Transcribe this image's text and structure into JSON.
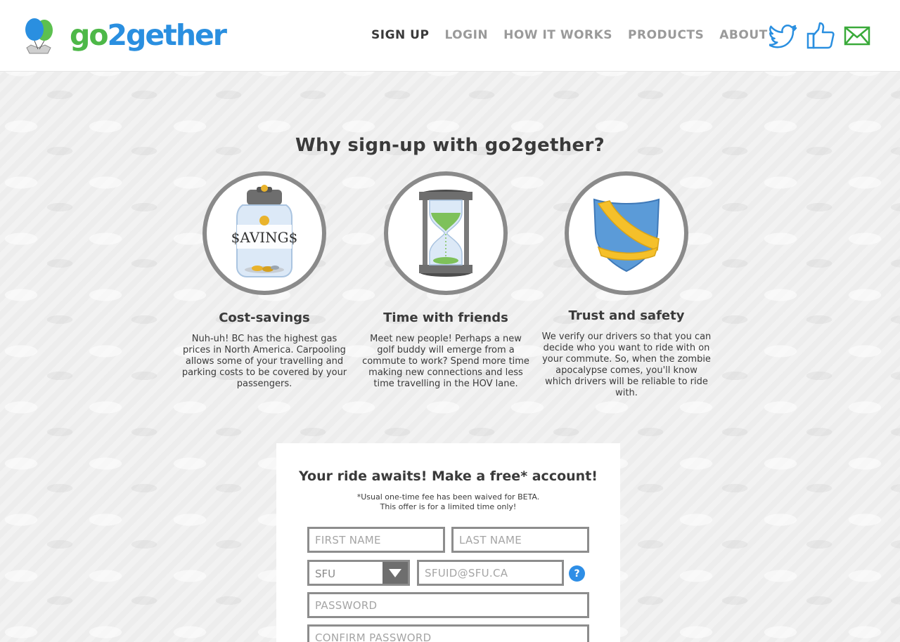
{
  "brand": {
    "logo_part1": "go",
    "logo_part2": "2gether"
  },
  "nav": [
    {
      "label": "SIGN UP"
    },
    {
      "label": "LOGIN"
    },
    {
      "label": "HOW IT WORKS"
    },
    {
      "label": "PRODUCTS"
    },
    {
      "label": "ABOUT"
    }
  ],
  "social_icons": [
    "twitter-icon",
    "like-thumb-icon",
    "email-icon"
  ],
  "intro": {
    "title": "Why sign-up with go2gether?",
    "features": [
      {
        "icon": "savings-jar-icon",
        "jar_label": "$AVING$",
        "heading": "Cost-savings",
        "text": "Nuh-uh! BC has the highest gas prices in North America. Carpooling allows some of your travelling and parking costs to be covered by your passengers."
      },
      {
        "icon": "hourglass-icon",
        "heading": "Time with friends",
        "text": "Meet new people! Perhaps a new golf buddy will emerge from a commute to work? Spend more time making new connections and less time travelling in the HOV lane."
      },
      {
        "icon": "shield-icon",
        "heading": "Trust and safety",
        "text": "We verify our drivers so that you can decide who you want to ride with on your commute. So, when the zombie apocalypse comes, you'll know which drivers will be reliable to ride with."
      }
    ]
  },
  "signup": {
    "title": "Your ride awaits! Make a free* account!",
    "fine_line1": "*Usual one-time fee has been waived for BETA.",
    "fine_line2": "This offer is for a limited time only!",
    "first_name_placeholder": "FIRST NAME",
    "last_name_placeholder": "LAST NAME",
    "school_selected": "SFU",
    "email_placeholder": "SFUID@SFU.CA",
    "help_label": "?",
    "password_placeholder": "PASSWORD",
    "confirm_password_placeholder": "CONFIRM PASSWORD"
  },
  "colors": {
    "brand_green": "#4db848",
    "brand_blue": "#2a8fe0",
    "shield_blue": "#5b9bd8",
    "shield_sash": "#f5c02a",
    "hourglass_sand": "#7ec15a"
  }
}
